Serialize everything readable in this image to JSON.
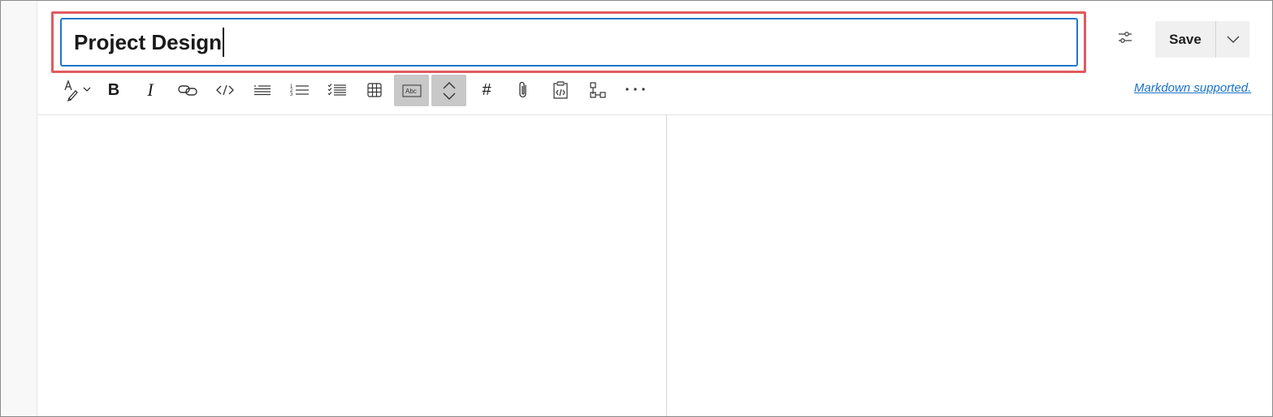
{
  "title_input": {
    "value": "Project Design"
  },
  "header": {
    "save_label": "Save"
  },
  "toolbar": {
    "items": [
      {
        "icon": "text-format-icon"
      },
      {
        "icon": "bold-icon",
        "glyph": "B"
      },
      {
        "icon": "italic-icon",
        "glyph": "I"
      },
      {
        "icon": "link-icon"
      },
      {
        "icon": "code-icon",
        "glyph": "</>"
      },
      {
        "icon": "bulleted-list-icon"
      },
      {
        "icon": "numbered-list-icon"
      },
      {
        "icon": "checklist-icon"
      },
      {
        "icon": "table-icon"
      },
      {
        "icon": "text-box-icon",
        "glyph": "Abc",
        "active": true
      },
      {
        "icon": "collapse-expand-icon",
        "active": true
      },
      {
        "icon": "hashtag-icon",
        "glyph": "#"
      },
      {
        "icon": "attach-icon"
      },
      {
        "icon": "code-snippet-icon"
      },
      {
        "icon": "diagram-icon"
      },
      {
        "icon": "more-icon",
        "glyph": "···"
      }
    ],
    "markdown_label": "Markdown supported."
  },
  "colors": {
    "highlight": "#e05a5f",
    "focus": "#1d77c9",
    "link": "#1b73c6",
    "active_bg": "#c8c8c8"
  }
}
